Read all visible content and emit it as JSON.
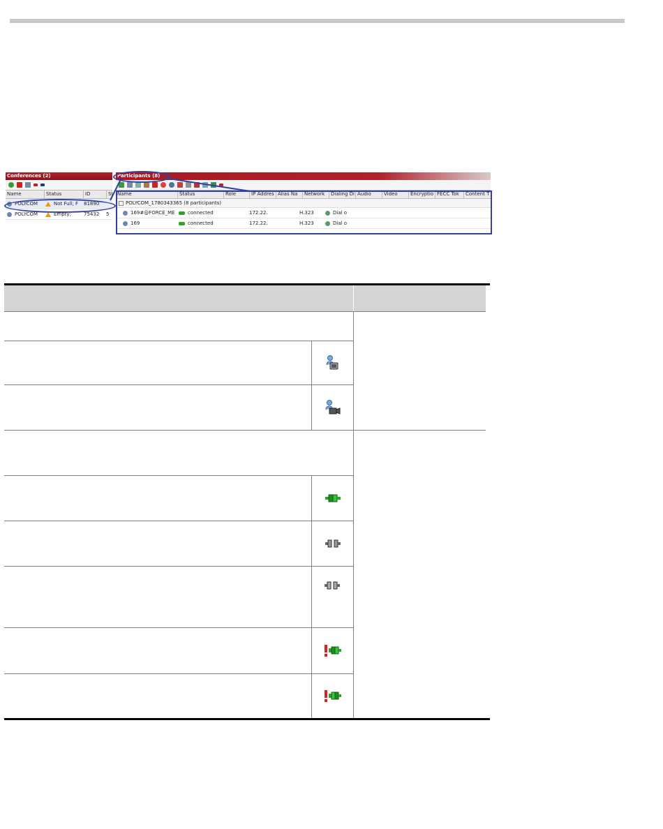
{
  "conferences_pane": {
    "title": "Conferences (2)",
    "columns": [
      "Name",
      "Status",
      "ID",
      "St"
    ],
    "rows": [
      {
        "name": "POLYCOM",
        "status": "Not Full; F",
        "id": "81890",
        "st": ""
      },
      {
        "name": "POLYCOM",
        "status": "Empty;",
        "id": "75432",
        "st": "5"
      }
    ]
  },
  "participants_pane": {
    "title": "Participants (8)",
    "columns": [
      "Name",
      "Status",
      "Role",
      "IP Addres",
      "Alias Na",
      "Network",
      "Dialing Di",
      "Audio",
      "Video",
      "Encryptio",
      "FECC Tok",
      "Content T"
    ],
    "group_label": "POLYCOM_1780343365 (8 participants)",
    "rows": [
      {
        "name": "169#@FORCE_ME",
        "status": "connected",
        "ip": "172.22.",
        "network": "H.323",
        "dialing": "Dial o"
      },
      {
        "name": "169",
        "status": "connected",
        "ip": "172.22.",
        "network": "H.323",
        "dialing": "Dial o"
      }
    ]
  },
  "table": {
    "icons": [
      "participant-video-icon",
      "participant-video-alt-icon",
      "connected-icon",
      "disconnected-icon",
      "disconnected-alt-icon",
      "connected-alert-icon",
      "connected-alert-alt-icon"
    ]
  },
  "colors": {
    "header_bar": "#b5222b",
    "callout": "#3340a0",
    "connected": "#2da52d",
    "alert": "#e02020"
  }
}
